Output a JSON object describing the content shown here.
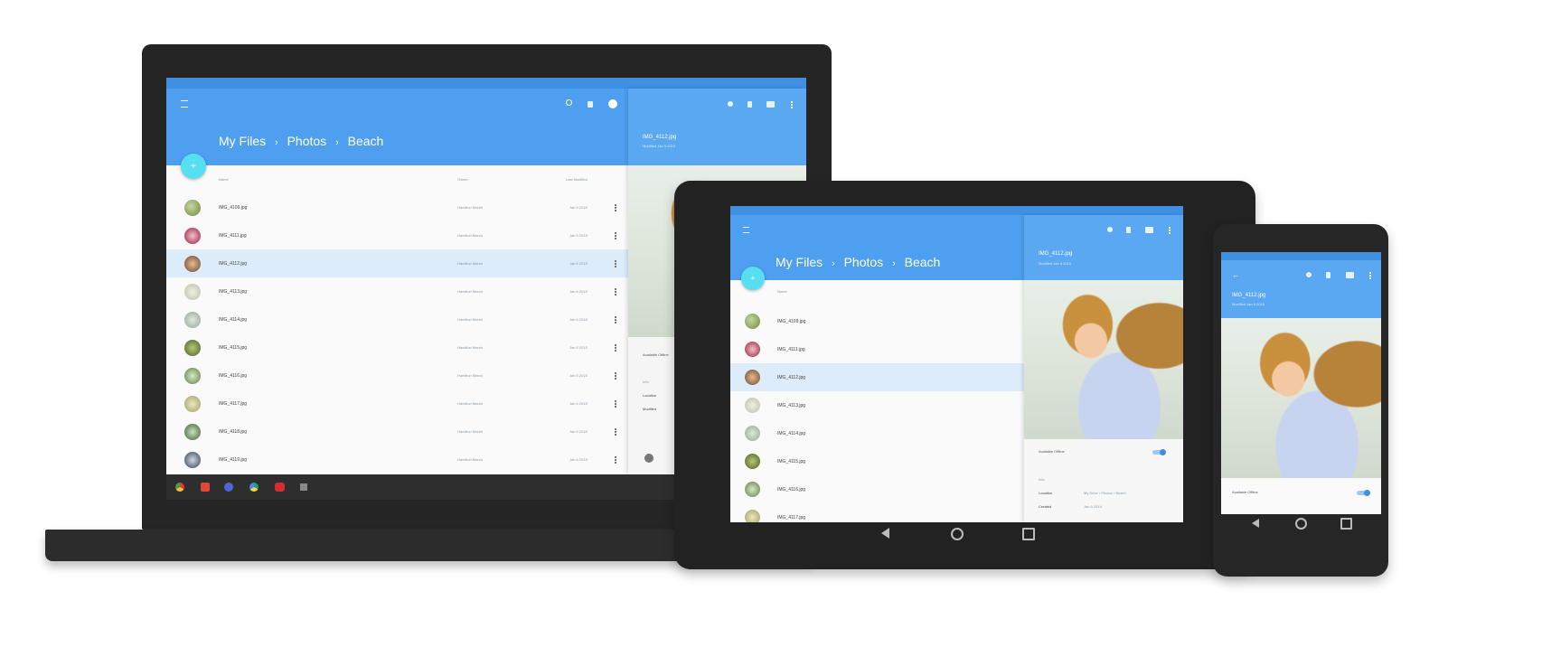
{
  "breadcrumb": {
    "root": "My Files",
    "sep": "›",
    "folder": "Photos",
    "current": "Beach"
  },
  "fab_label": "+",
  "columns": {
    "name": "Name",
    "owner": "Owner",
    "modified": "Last Modified"
  },
  "laptop_files": [
    {
      "name": "IMG_4109.jpg",
      "owner": "Hamilton Marsh",
      "date": "Jan 5 2015"
    },
    {
      "name": "IMG_4111.jpg",
      "owner": "Hamilton Marsh",
      "date": "Jan 5 2015"
    },
    {
      "name": "IMG_4112.jpg",
      "owner": "Hamilton Marsh",
      "date": "Jan 5 2015"
    },
    {
      "name": "IMG_4113.jpg",
      "owner": "Hamilton Marsh",
      "date": "Jan 6 2015"
    },
    {
      "name": "IMG_4114.jpg",
      "owner": "Hamilton Marsh",
      "date": "Jan 6 2015"
    },
    {
      "name": "IMG_4115.jpg",
      "owner": "Hamilton Marsh",
      "date": "Jan 6 2015"
    },
    {
      "name": "IMG_4116.jpg",
      "owner": "Hamilton Marsh",
      "date": "Jan 6 2015"
    },
    {
      "name": "IMG_4117.jpg",
      "owner": "Hamilton Marsh",
      "date": "Jan 6 2015"
    },
    {
      "name": "IMG_4118.jpg",
      "owner": "Hamilton Marsh",
      "date": "Jan 6 2015"
    },
    {
      "name": "IMG_4119.jpg",
      "owner": "Hamilton Marsh",
      "date": "Jan 6 2015"
    }
  ],
  "tablet_files": [
    "IMG_4109.jpg",
    "IMG_4111.jpg",
    "IMG_4112.jpg",
    "IMG_4113.jpg",
    "IMG_4114.jpg",
    "IMG_4115.jpg",
    "IMG_4116.jpg",
    "IMG_4117.jpg"
  ],
  "detail": {
    "file": "IMG_4112.jpg",
    "subtitle": "Modified Jan 5 2015",
    "offline_label": "Available Offline",
    "info_label": "Info",
    "location_label": "Location",
    "location_value": "My Drive › Photos › Beach",
    "created_label": "Created",
    "created_value": "Jan 5 2014",
    "modified_label": "Modified"
  },
  "colors": {
    "primary": "#4e9ff0",
    "selected_row": "#dcecfb",
    "device": "#2a2a2a"
  }
}
